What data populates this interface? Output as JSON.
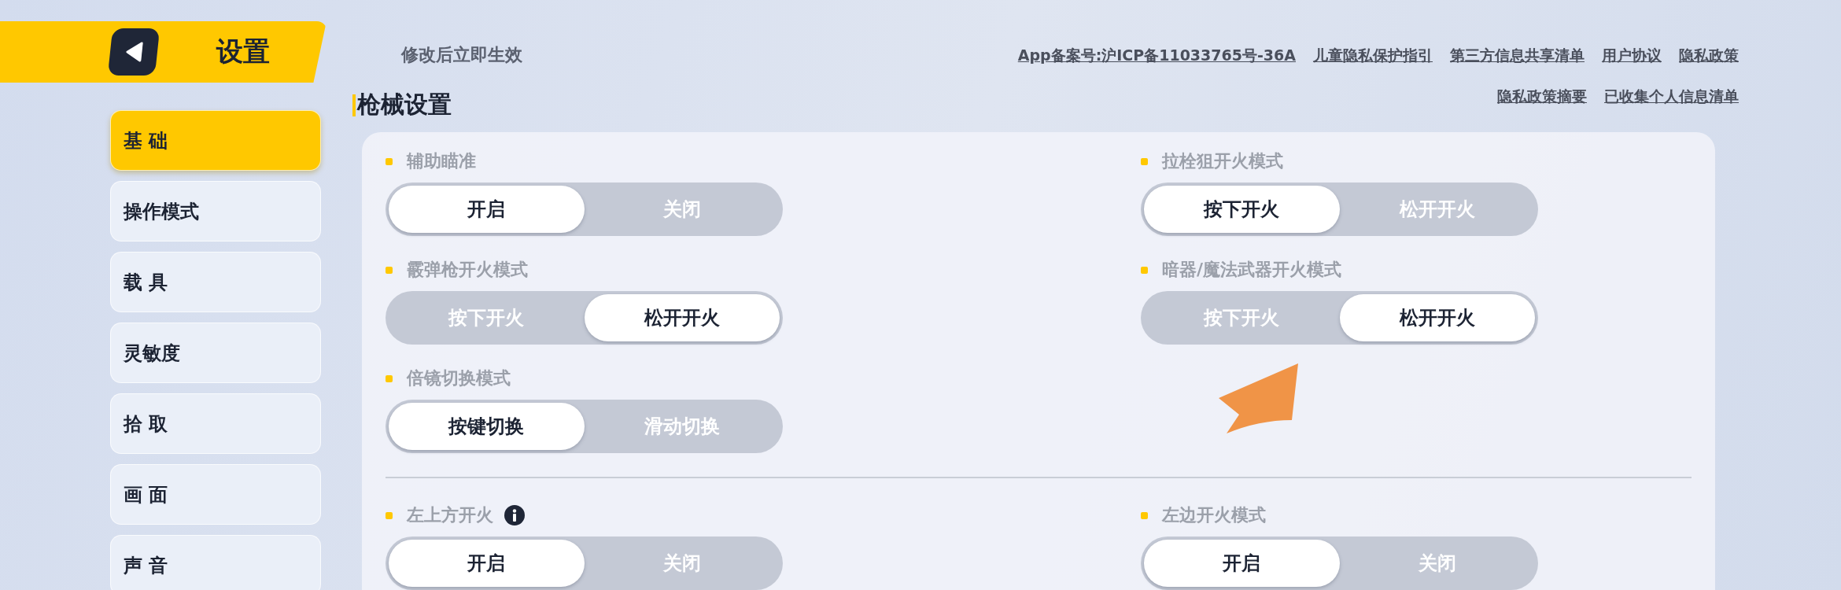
{
  "header": {
    "title": "设置"
  },
  "notice": "修改后立即生效",
  "links": [
    [
      "App备案号:沪ICP备11033765号-36A",
      "儿童隐私保护指引",
      "第三方信息共享清单",
      "用户协议",
      "隐私政策"
    ],
    [
      "隐私政策摘要",
      "已收集个人信息清单"
    ]
  ],
  "sidebar": {
    "items": [
      {
        "label": "基 础",
        "selected": true
      },
      {
        "label": "操作模式",
        "selected": false
      },
      {
        "label": "载 具",
        "selected": false
      },
      {
        "label": "灵敏度",
        "selected": false
      },
      {
        "label": "拾 取",
        "selected": false
      },
      {
        "label": "画 面",
        "selected": false
      },
      {
        "label": "声 音",
        "selected": false
      }
    ]
  },
  "section": {
    "title": "枪械设置",
    "groups": [
      {
        "columns": [
          [
            {
              "label": "辅助瞄准",
              "info": false,
              "options": [
                {
                  "label": "开启",
                  "selected": true
                },
                {
                  "label": "关闭",
                  "selected": false
                }
              ]
            },
            {
              "label": "霰弹枪开火模式",
              "info": false,
              "options": [
                {
                  "label": "按下开火",
                  "selected": false
                },
                {
                  "label": "松开开火",
                  "selected": true
                }
              ]
            },
            {
              "label": "倍镜切换模式",
              "info": false,
              "options": [
                {
                  "label": "按键切换",
                  "selected": true
                },
                {
                  "label": "滑动切换",
                  "selected": false
                }
              ]
            }
          ],
          [
            {
              "label": "拉栓狙开火模式",
              "info": false,
              "options": [
                {
                  "label": "按下开火",
                  "selected": true
                },
                {
                  "label": "松开开火",
                  "selected": false
                }
              ]
            },
            {
              "label": "暗器/魔法武器开火模式",
              "info": false,
              "options": [
                {
                  "label": "按下开火",
                  "selected": false
                },
                {
                  "label": "松开开火",
                  "selected": true
                }
              ]
            }
          ]
        ]
      },
      {
        "columns": [
          [
            {
              "label": "左上方开火",
              "info": true,
              "options": [
                {
                  "label": "开启",
                  "selected": true
                },
                {
                  "label": "关闭",
                  "selected": false
                }
              ]
            }
          ],
          [
            {
              "label": "左边开火模式",
              "info": false,
              "options": [
                {
                  "label": "开启",
                  "selected": true
                },
                {
                  "label": "关闭",
                  "selected": false
                }
              ]
            }
          ]
        ]
      }
    ]
  }
}
